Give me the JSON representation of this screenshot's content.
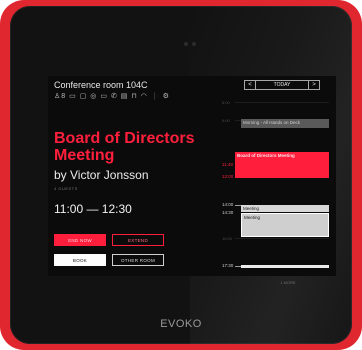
{
  "device": {
    "brand": "EVOKO",
    "colors": {
      "frame": "#e0262f",
      "bezel": "#121212",
      "accent": "#ff1f3d"
    }
  },
  "room": {
    "name": "Conference room 104C",
    "capacity": "8",
    "amenity_icons": [
      "person-icon",
      "display-icon",
      "videoconference-icon",
      "camera-icon",
      "screen-share-icon",
      "phone-icon",
      "whiteboard-icon",
      "flipchart-icon",
      "wifi-icon",
      "settings-icon"
    ]
  },
  "meeting": {
    "title": "Board of Directors Meeting",
    "organizer": "by Victor Jonsson",
    "guests": "4 GUESTS",
    "time_range": "11:00 — 12:30"
  },
  "actions": {
    "end_now": "END NOW",
    "extend": "EXTEND",
    "book": "BOOK",
    "other_room": "OTHER ROOM"
  },
  "calendar": {
    "nav_label": "TODAY",
    "prev": "<",
    "next": ">",
    "times": {
      "t0800": "8:00",
      "t0900": "9:00",
      "t1148": "11:48",
      "t1200": "12:00",
      "t1400": "14:00",
      "t1430": "14:30",
      "t1600": "16:00",
      "t1730": "17:30"
    },
    "events": {
      "all_hands": "Morning - All Hands on Deck",
      "board": "Board of Directors Meeting",
      "meeting_1": "Meeting",
      "meeting_2": "Meeting"
    },
    "more": "1 MORE"
  }
}
